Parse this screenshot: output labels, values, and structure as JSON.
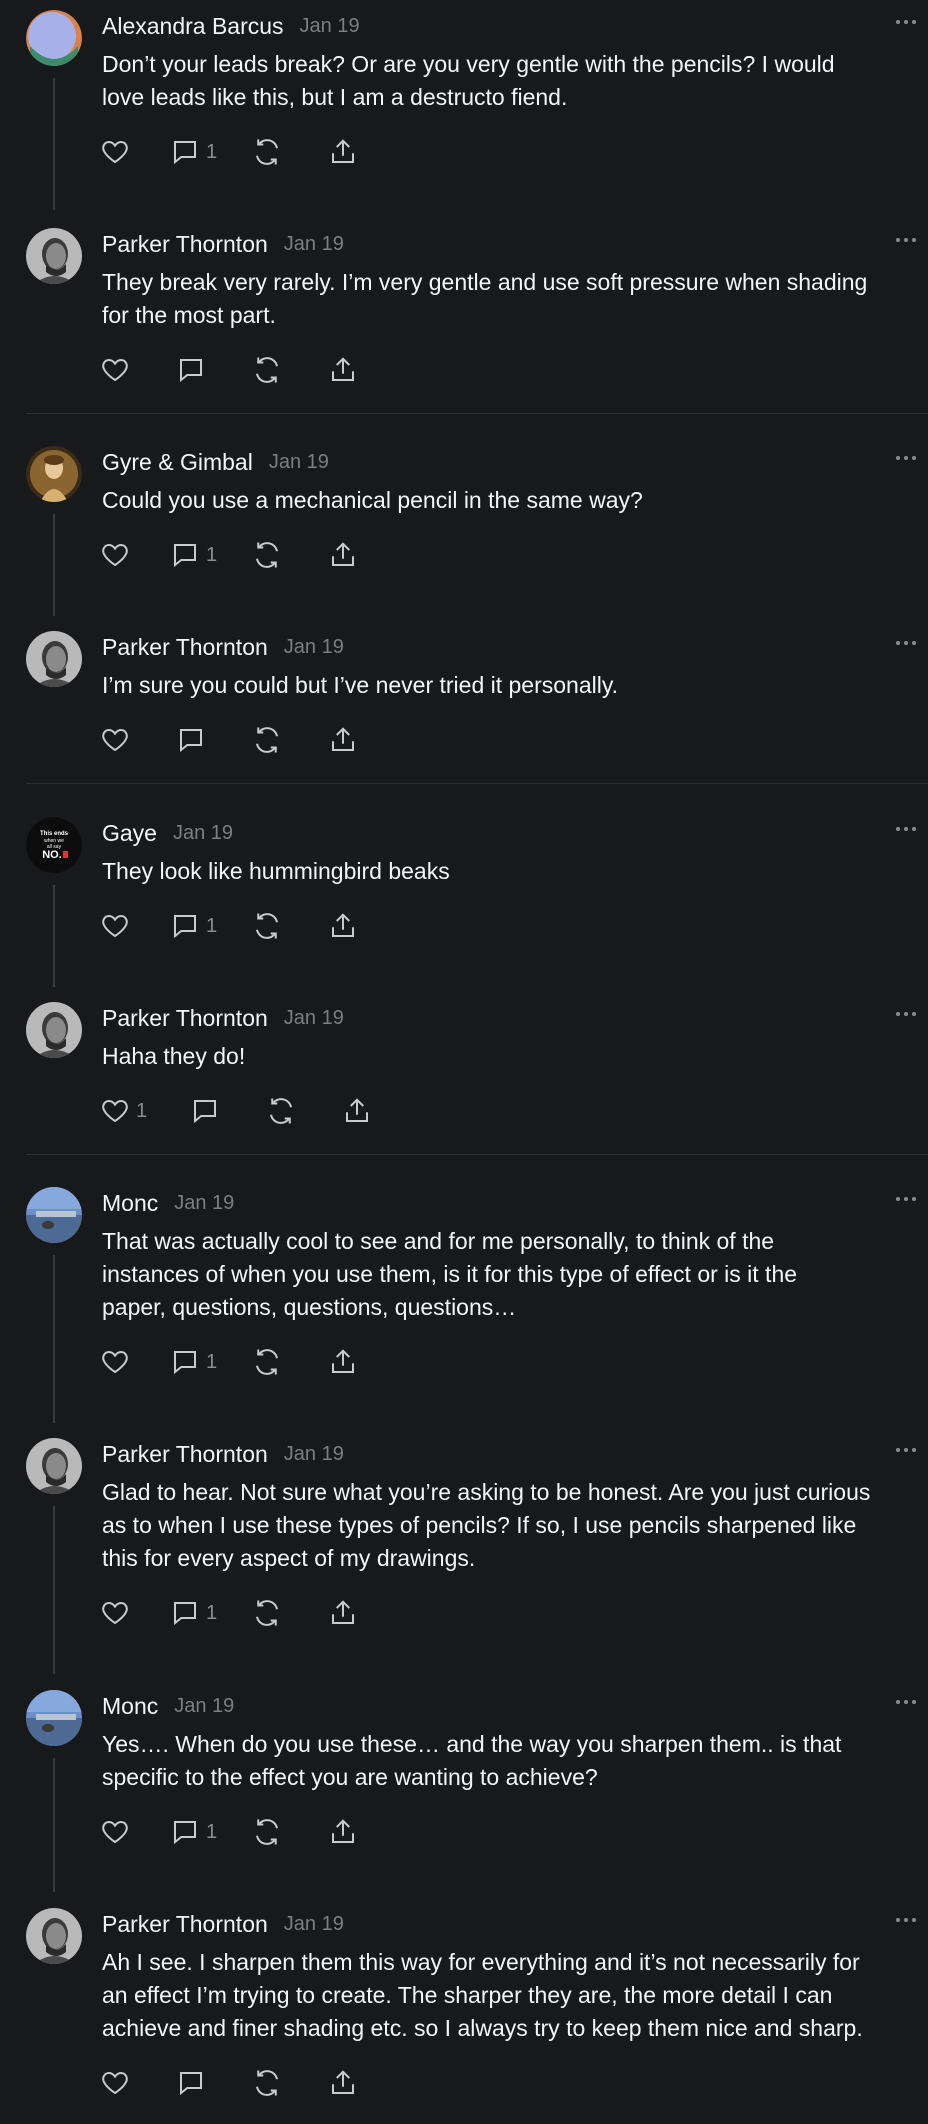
{
  "posts": [
    {
      "author": "Alexandra Barcus",
      "date": "Jan 19",
      "text": "Don’t your leads break? Or are you very gentle with the pencils? I would\nlove leads like this, but I am a destructo fiend.",
      "likes": "",
      "replies": "1"
    },
    {
      "author": "Parker Thornton",
      "date": "Jan 19",
      "text": "They break very rarely. I’m very gentle and use soft pressure when shading\nfor the most part.",
      "likes": "",
      "replies": ""
    },
    {
      "author": "Gyre & Gimbal",
      "date": "Jan 19",
      "text": "Could you use a mechanical pencil in the same way?",
      "likes": "",
      "replies": "1"
    },
    {
      "author": "Parker Thornton",
      "date": "Jan 19",
      "text": "I’m sure you could but I’ve never tried it personally.",
      "likes": "",
      "replies": ""
    },
    {
      "author": "Gaye",
      "date": "Jan 19",
      "text": "They look like hummingbird beaks",
      "likes": "",
      "replies": "1",
      "avatar_text": [
        "This ends",
        "when we",
        "all say",
        "NO."
      ]
    },
    {
      "author": "Parker Thornton",
      "date": "Jan 19",
      "text": "Haha they do!",
      "likes": "1",
      "replies": ""
    },
    {
      "author": "Monc",
      "date": "Jan 19",
      "text": "That was actually cool to see and for me personally, to think of the\ninstances of when you use them, is it for this type of effect or is it the\npaper, questions, questions, questions…",
      "likes": "",
      "replies": "1"
    },
    {
      "author": "Parker Thornton",
      "date": "Jan 19",
      "text": "Glad to hear. Not sure what you’re asking to be honest. Are you just curious\nas to when I use these types of pencils? If so, I use pencils sharpened like\nthis for every aspect of my drawings.",
      "likes": "",
      "replies": "1"
    },
    {
      "author": "Monc",
      "date": "Jan 19",
      "text": "Yes…. When do you use these… and the way you sharpen them.. is that\nspecific to the effect you are wanting to achieve?",
      "likes": "",
      "replies": "1"
    },
    {
      "author": "Parker Thornton",
      "date": "Jan 19",
      "text": "Ah I see. I sharpen them this way for everything and it’s not necessarily for\nan effect I’m trying to create. The sharper they are, the more detail I can\nachieve and finer shading etc. so I always try to keep them nice and sharp.",
      "likes": "",
      "replies": ""
    }
  ],
  "colors": {
    "background": "#18191b",
    "text": "#f3f5f7",
    "muted": "#7d7e80",
    "line": "#3a3b3d"
  },
  "icons": [
    "heart-icon",
    "comment-icon",
    "repost-icon",
    "share-icon",
    "more-icon"
  ]
}
